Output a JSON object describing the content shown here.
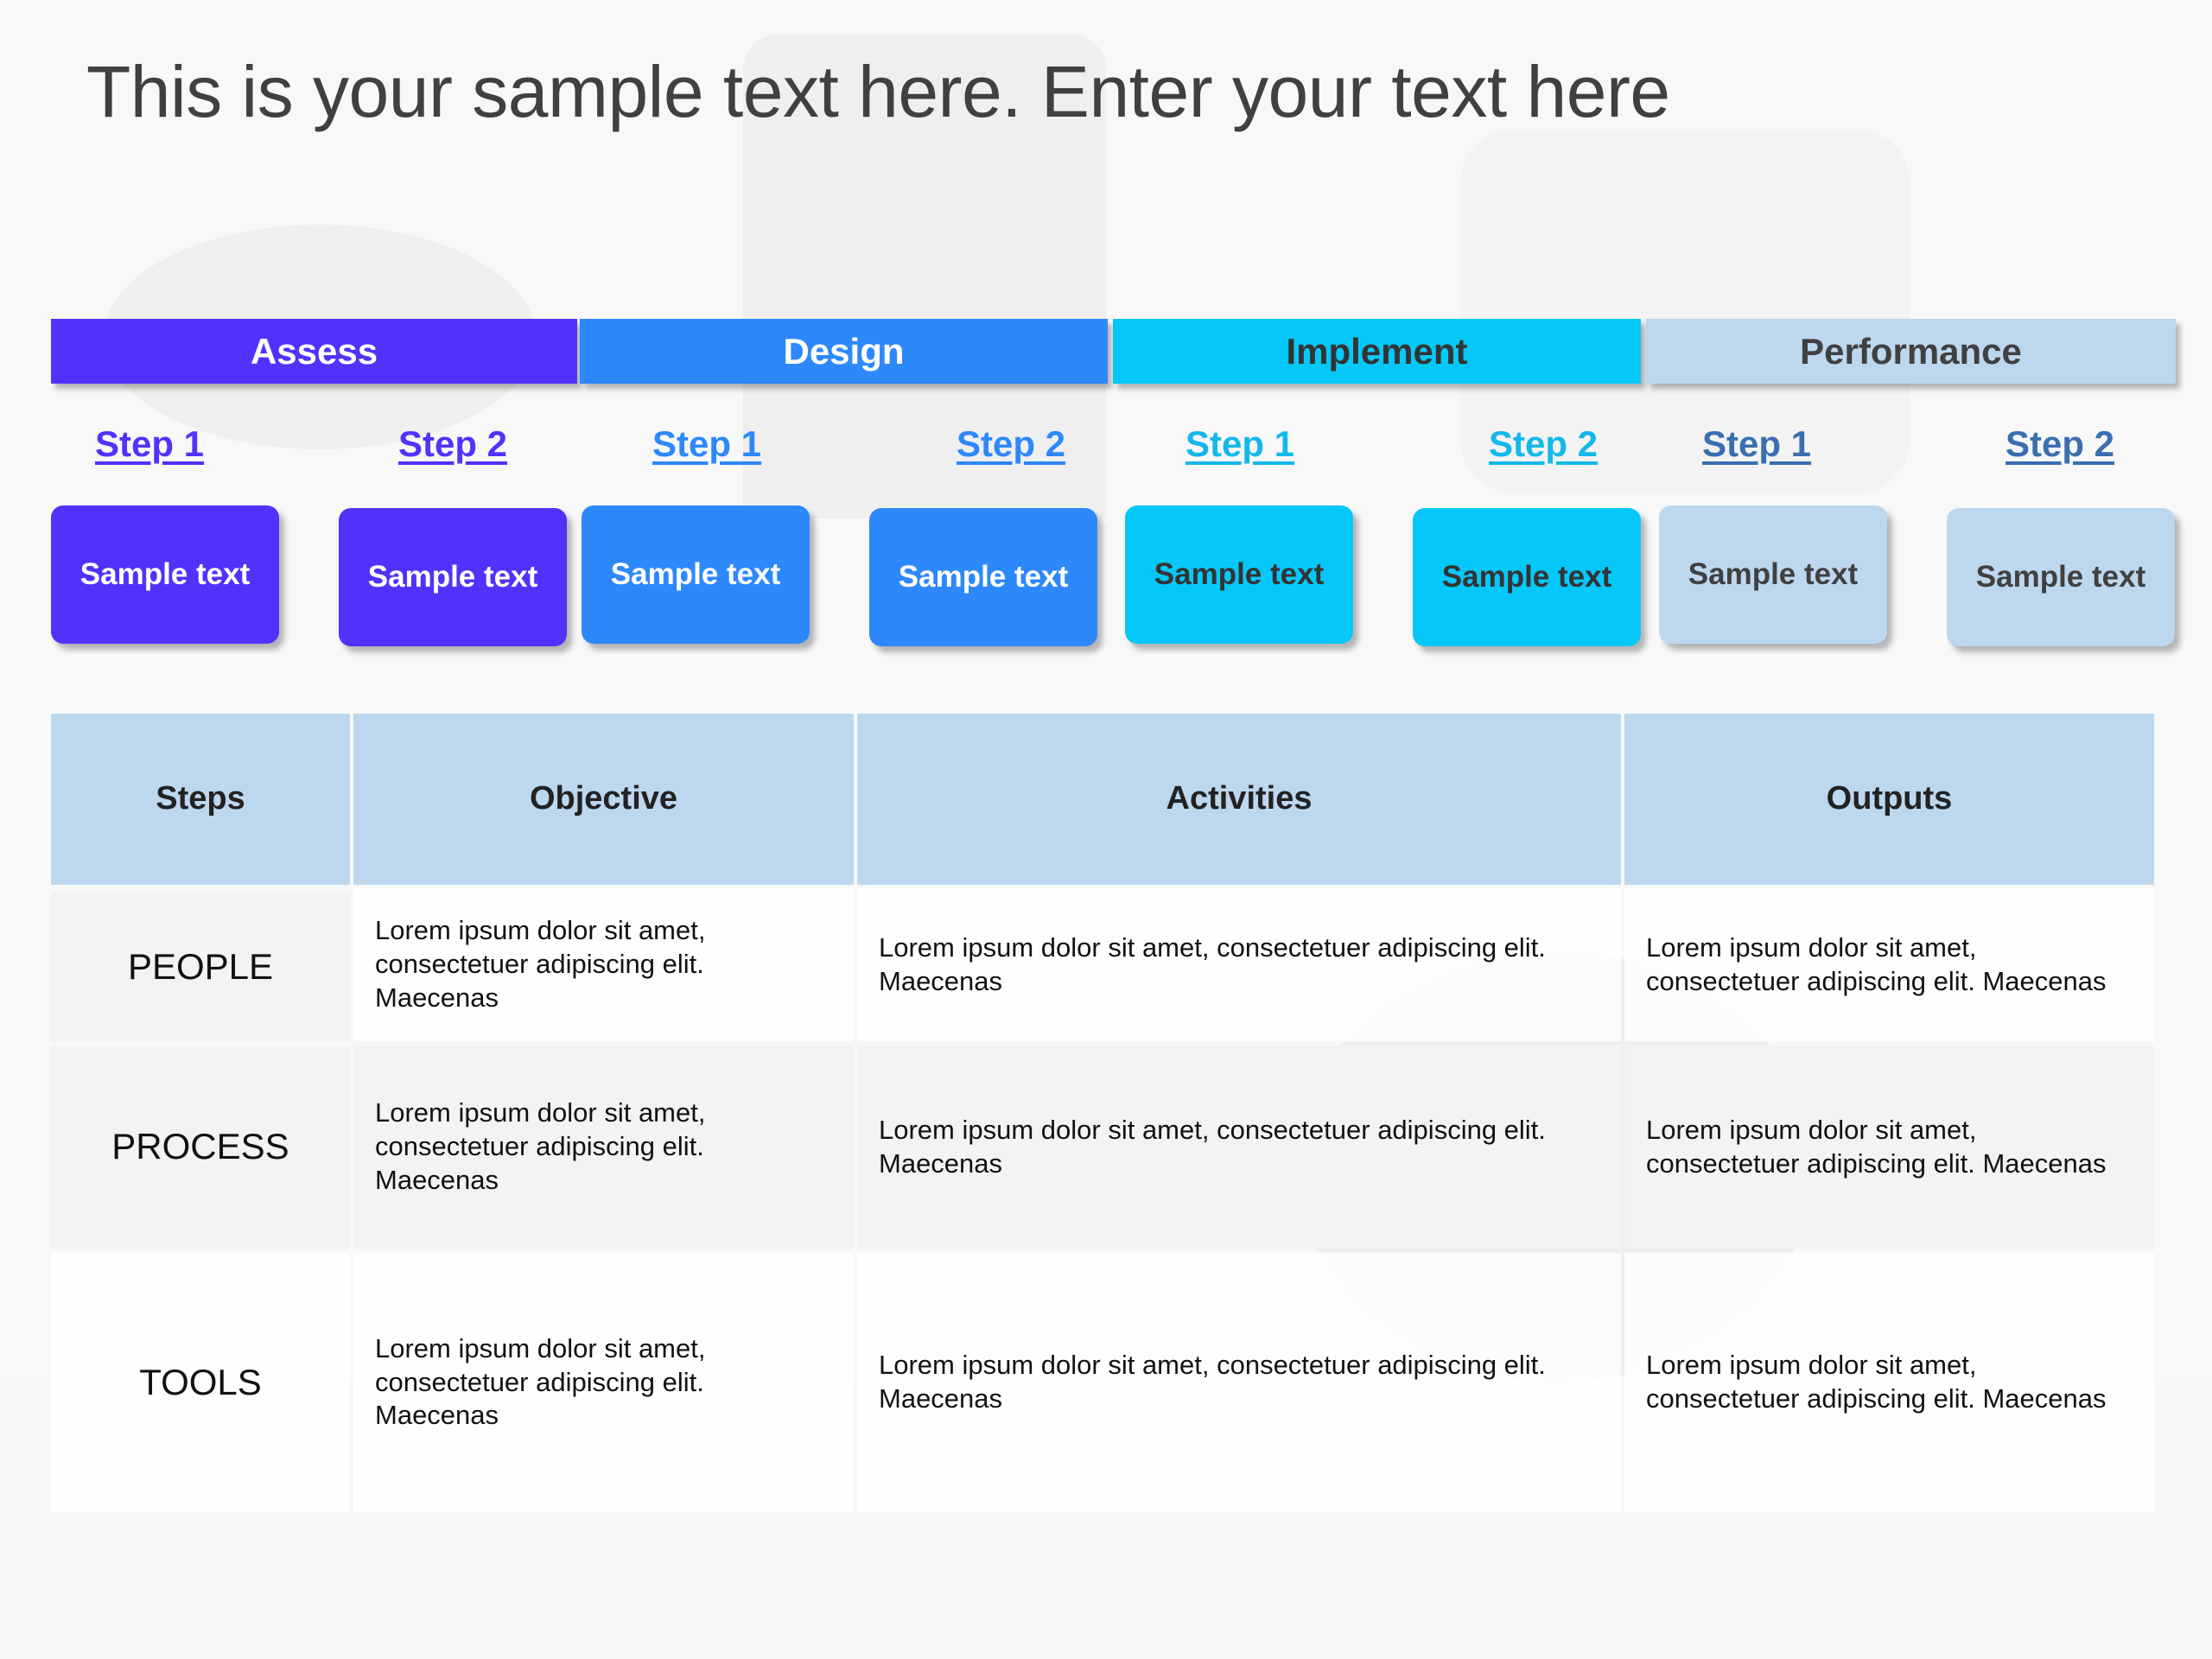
{
  "title": "This is your sample text here. Enter your text here",
  "colors": {
    "assess": "#5232fb",
    "design": "#2d88fb",
    "implement": "#06c8f8",
    "performance": "#bdd7ee",
    "header_fill": "#bdd7ee"
  },
  "phases": [
    {
      "label": "Assess",
      "steps": [
        {
          "link": "Step 1",
          "box": "Sample text"
        },
        {
          "link": "Step 2",
          "box": "Sample text"
        }
      ]
    },
    {
      "label": "Design",
      "steps": [
        {
          "link": "Step 1",
          "box": "Sample text"
        },
        {
          "link": "Step 2",
          "box": "Sample text"
        }
      ]
    },
    {
      "label": "Implement",
      "steps": [
        {
          "link": "Step 1",
          "box": "Sample text"
        },
        {
          "link": "Step 2",
          "box": "Sample text"
        }
      ]
    },
    {
      "label": "Performance",
      "steps": [
        {
          "link": "Step 1",
          "box": "Sample text"
        },
        {
          "link": "Step 2",
          "box": "Sample text"
        }
      ]
    }
  ],
  "table": {
    "headers": [
      "Steps",
      "Objective",
      "Activities",
      "Outputs"
    ],
    "rows": [
      {
        "label": "PEOPLE",
        "objective": "Lorem ipsum dolor sit amet, consectetuer adipiscing elit. Maecenas",
        "activities": "Lorem ipsum dolor sit amet, consectetuer adipiscing elit. Maecenas",
        "outputs": "Lorem ipsum dolor sit amet, consectetuer adipiscing elit. Maecenas"
      },
      {
        "label": "PROCESS",
        "objective": "Lorem ipsum dolor sit amet, consectetuer adipiscing elit. Maecenas",
        "activities": "Lorem ipsum dolor sit amet, consectetuer adipiscing elit. Maecenas",
        "outputs": "Lorem ipsum dolor sit amet, consectetuer adipiscing elit. Maecenas"
      },
      {
        "label": "TOOLS",
        "objective": "Lorem ipsum dolor sit amet, consectetuer adipiscing elit. Maecenas",
        "activities": "Lorem ipsum dolor sit amet, consectetuer adipiscing elit. Maecenas",
        "outputs": "Lorem ipsum dolor sit amet, consectetuer adipiscing elit. Maecenas"
      }
    ]
  }
}
